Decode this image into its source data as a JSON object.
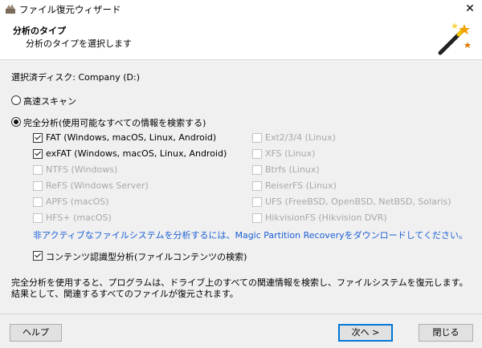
{
  "window": {
    "title": "ファイル復元ウィザード",
    "close_glyph": "✕"
  },
  "header": {
    "title": "分析のタイプ",
    "subtitle": "分析のタイプを選択します"
  },
  "disk": {
    "label": "選択済ディスク:",
    "value": "Company (D:)"
  },
  "options": {
    "fast_scan": {
      "label": "高速スキャン",
      "selected": false
    },
    "full_analysis": {
      "label": "完全分析(使用可能なすべての情報を検索する)",
      "selected": true
    }
  },
  "filesystems_left": [
    {
      "label": "FAT (Windows, macOS, Linux, Android)",
      "checked": true,
      "enabled": true
    },
    {
      "label": "exFAT (Windows, macOS, Linux, Android)",
      "checked": true,
      "enabled": true
    },
    {
      "label": "NTFS (Windows)",
      "checked": false,
      "enabled": false
    },
    {
      "label": "ReFS (Windows Server)",
      "checked": false,
      "enabled": false
    },
    {
      "label": "APFS (macOS)",
      "checked": false,
      "enabled": false
    },
    {
      "label": "HFS+ (macOS)",
      "checked": false,
      "enabled": false
    }
  ],
  "filesystems_right": [
    {
      "label": "Ext2/3/4 (Linux)",
      "checked": false,
      "enabled": false
    },
    {
      "label": "XFS (Linux)",
      "checked": false,
      "enabled": false
    },
    {
      "label": "Btrfs (Linux)",
      "checked": false,
      "enabled": false
    },
    {
      "label": "ReiserFS (Linux)",
      "checked": false,
      "enabled": false
    },
    {
      "label": "UFS (FreeBSD, OpenBSD, NetBSD, Solaris)",
      "checked": false,
      "enabled": false
    },
    {
      "label": "HikvisionFS (Hikvision DVR)",
      "checked": false,
      "enabled": false
    }
  ],
  "info_link": "非アクティブなファイルシステムを分析するには、Magic Partition Recoveryをダウンロードしてください。",
  "content_analysis": {
    "label": "コンテンツ認識型分析(ファイルコンテンツの検索)",
    "checked": true
  },
  "description": "完全分析を使用すると、プログラムは、ドライブ上のすべての関連情報を検索し、ファイルシステムを復元します。結果として、関連するすべてのファイルが復元されます。",
  "buttons": {
    "help": "ヘルプ",
    "next": "次へ >",
    "close": "閉じる"
  }
}
